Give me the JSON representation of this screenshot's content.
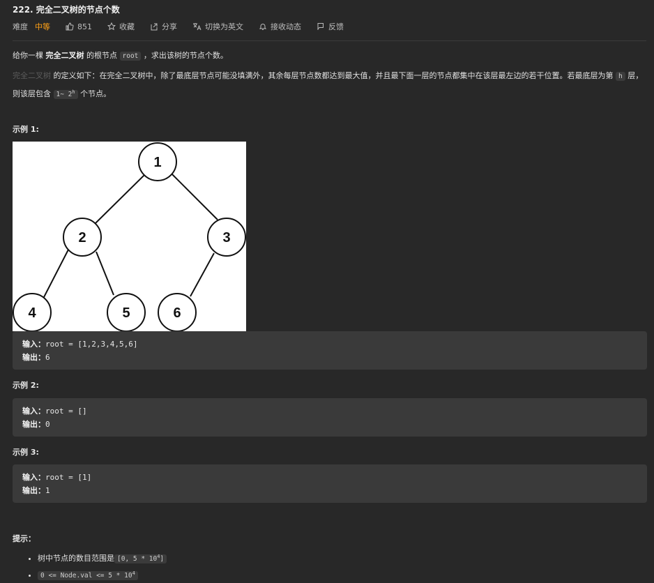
{
  "problem": {
    "title": "222. 完全二叉树的节点个数",
    "difficulty_label": "难度",
    "difficulty_value": "中等",
    "actions": {
      "like_count": "851",
      "favorite": "收藏",
      "share": "分享",
      "switch_lang": "切换为英文",
      "subscribe": "接收动态",
      "feedback": "反馈"
    }
  },
  "description": {
    "p1_prefix": "给你一棵 ",
    "p1_bold": "完全二叉树",
    "p1_mid": " 的根节点 ",
    "p1_code": "root",
    "p1_suffix": " ，求出该树的节点个数。",
    "p2_link": "完全二叉树",
    "p2_text1": " 的定义如下：在完全二叉树中，除了最底层节点可能没填满外，其余每层节点数都达到最大值，并且最下面一层的节点都集中在该层最左边的若干位置。若最底层为第 ",
    "p2_code_h": "h",
    "p2_text2": " 层，则该层包含 ",
    "p2_code_range_a": "1~ 2",
    "p2_code_range_sup": "h",
    "p2_text3": " 个节点。"
  },
  "examples": [
    {
      "title": "示例 1:",
      "input_label": "输入：",
      "input": "root = [1,2,3,4,5,6]",
      "output_label": "输出：",
      "output": "6",
      "tree_nodes": [
        "1",
        "2",
        "3",
        "4",
        "5",
        "6"
      ]
    },
    {
      "title": "示例 2:",
      "input_label": "输入：",
      "input": "root = []",
      "output_label": "输出：",
      "output": "0"
    },
    {
      "title": "示例 3:",
      "input_label": "输入：",
      "input": "root = [1]",
      "output_label": "输出：",
      "output": "1"
    }
  ],
  "hints": {
    "title": "提示：",
    "item1_text": "树中节点的数目范围是",
    "item1_code": "[0, 5 * 10",
    "item1_sup": "4",
    "item1_code_end": "]",
    "item2_code": "0 <= Node.val <= 5 * 10",
    "item2_sup": "4"
  },
  "colors": {
    "background": "#282828",
    "accent_medium": "#ffa116",
    "code_block": "#3a3a3a"
  }
}
